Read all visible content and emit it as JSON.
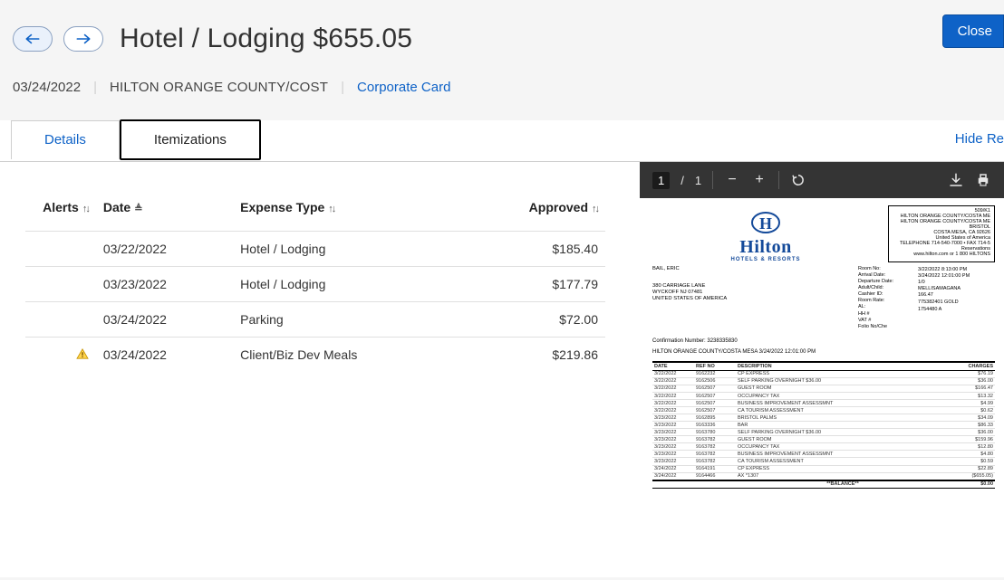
{
  "header": {
    "title": "Hotel / Lodging $655.05",
    "close_label": "Close"
  },
  "meta": {
    "date": "03/24/2022",
    "vendor": "HILTON ORANGE COUNTY/COST",
    "payment": "Corporate Card"
  },
  "tabs": {
    "details": "Details",
    "itemizations": "Itemizations",
    "hide_receipt": "Hide Re"
  },
  "table": {
    "headers": {
      "alerts": "Alerts",
      "date": "Date",
      "expense_type": "Expense Type",
      "approved": "Approved"
    },
    "rows": [
      {
        "alert": false,
        "date": "03/22/2022",
        "type": "Hotel / Lodging",
        "approved": "$185.40"
      },
      {
        "alert": false,
        "date": "03/23/2022",
        "type": "Hotel / Lodging",
        "approved": "$177.79"
      },
      {
        "alert": false,
        "date": "03/24/2022",
        "type": "Parking",
        "approved": "$72.00"
      },
      {
        "alert": true,
        "date": "03/24/2022",
        "type": "Client/Biz Dev Meals",
        "approved": "$219.86"
      }
    ]
  },
  "pdf_toolbar": {
    "page_current": "1",
    "page_total": "1",
    "slash": "/"
  },
  "receipt": {
    "top_right": {
      "room_line": "509/K1",
      "hotel_name": "HILTON ORANGE COUNTY/COSTA ME",
      "hotel_name2": "HILTON ORANGE COUNTY/COSTA ME",
      "city_line": "BRISTOL",
      "city_state": "COSTA MESA, CA  92626",
      "country": "United States of America",
      "phone": "TELEPHONE 714-540-7000 • FAX 714-5",
      "res": "Reservations",
      "web": "www.hilton.com or 1 800 HILTONS"
    },
    "guest": {
      "name": "BAIL, ERIC",
      "addr1": "380 CARRIAGE LANE",
      "addr2": "WYCKOFF NJ  07481",
      "addr3": "UNITED STATES OF AMERICA"
    },
    "labels": {
      "room_no": "Room No:",
      "arrival": "Arrival Date:",
      "departure": "Departure Date:",
      "adultchild": "Adult/Child:",
      "cashier": "Cashier ID:",
      "rate": "Room Rate:",
      "al": "AL:",
      "hh": "HH #",
      "vat": "VAT #",
      "folio": "Folio No/Che"
    },
    "values": {
      "room_no": "",
      "arrival": "3/22/2022  8:13:00 PM",
      "departure": "3/24/2022 12:01:00 PM",
      "adultchild": "1/0",
      "cashier": "MELLISAMAGANA",
      "rate": "166.47",
      "al": "",
      "hh": "775382401 GOLD",
      "vat": "",
      "folio": "1754480 A"
    },
    "conf_label": "Confirmation Number: 3238335830",
    "billed_line": "HILTON ORANGE COUNTY/COSTA MESA 3/24/2022 12:01:00 PM",
    "charge_headers": {
      "date": "DATE",
      "ref": "REF NO",
      "desc": "DESCRIPTION",
      "charge": "CHARGES"
    },
    "charges": [
      {
        "date": "3/22/2022",
        "ref": "9162232",
        "desc": "CP EXPRESS",
        "charge": "$76.19"
      },
      {
        "date": "3/22/2022",
        "ref": "9162506",
        "desc": "SELF PARKING OVERNIGHT $36.00",
        "charge": "$36.00"
      },
      {
        "date": "3/22/2022",
        "ref": "9162507",
        "desc": "GUEST ROOM",
        "charge": "$166.47"
      },
      {
        "date": "3/22/2022",
        "ref": "9162507",
        "desc": "OCCUPANCY TAX",
        "charge": "$13.32"
      },
      {
        "date": "3/22/2022",
        "ref": "9162507",
        "desc": "BUSINESS IMPROVEMENT ASSESSMNT",
        "charge": "$4.99"
      },
      {
        "date": "3/22/2022",
        "ref": "9162507",
        "desc": "CA TOURISM ASSESSMENT",
        "charge": "$0.62"
      },
      {
        "date": "3/23/2022",
        "ref": "9162895",
        "desc": "BRISTOL PALMS",
        "charge": "$34.09"
      },
      {
        "date": "3/23/2022",
        "ref": "9163336",
        "desc": "BAR",
        "charge": "$86.33"
      },
      {
        "date": "3/23/2022",
        "ref": "9163780",
        "desc": "SELF PARKING OVERNIGHT $36.00",
        "charge": "$36.00"
      },
      {
        "date": "3/23/2022",
        "ref": "9163782",
        "desc": "GUEST ROOM",
        "charge": "$159.96"
      },
      {
        "date": "3/23/2022",
        "ref": "9163782",
        "desc": "OCCUPANCY TAX",
        "charge": "$12.80"
      },
      {
        "date": "3/23/2022",
        "ref": "9163782",
        "desc": "BUSINESS IMPROVEMENT ASSESSMNT",
        "charge": "$4.80"
      },
      {
        "date": "3/23/2022",
        "ref": "9163782",
        "desc": "CA TOURISM ASSESSMENT",
        "charge": "$0.59"
      },
      {
        "date": "3/24/2022",
        "ref": "9164191",
        "desc": "CP EXPRESS",
        "charge": "$22.89"
      },
      {
        "date": "3/24/2022",
        "ref": "9164466",
        "desc": "AX *1307",
        "charge": "($655.05)"
      }
    ],
    "balance_label": "**BALANCE**",
    "balance_value": "$0.00",
    "logo_word": "Hilton",
    "logo_sub": "HOTELS & RESORTS"
  }
}
